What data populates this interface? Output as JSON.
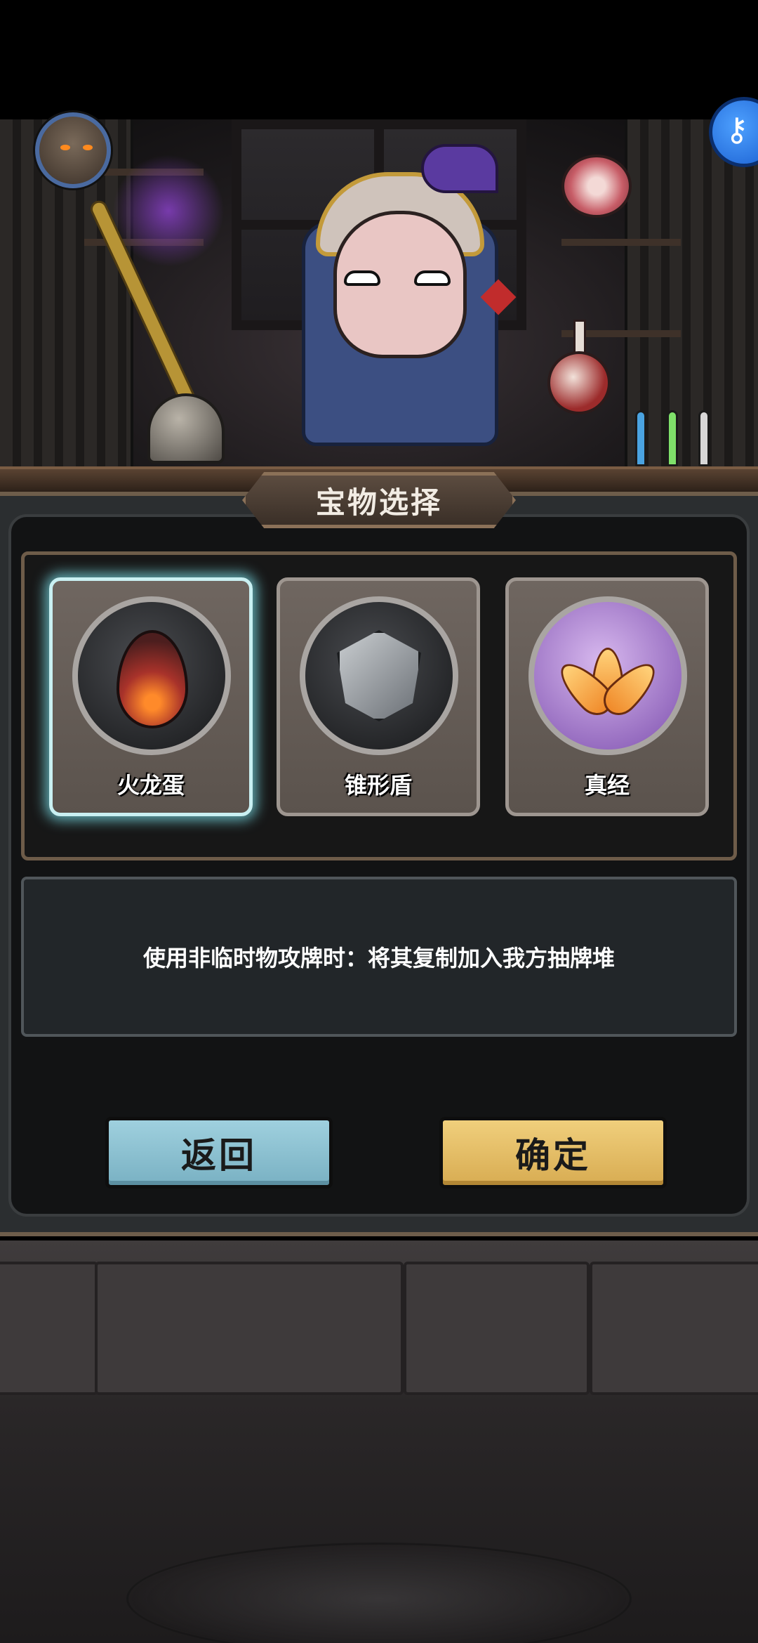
{
  "hud": {
    "avatar_icon": "hero-portrait-icon",
    "key_icon": "key-icon"
  },
  "scene": {
    "description_icons": [
      "merchant-character",
      "magic-staff",
      "knight-helmet",
      "potion-flask",
      "ham-meat"
    ]
  },
  "panel": {
    "title": "宝物选择"
  },
  "treasures": [
    {
      "name": "火龙蛋",
      "icon": "dragon-egg-icon",
      "selected": true
    },
    {
      "name": "锥形盾",
      "icon": "cone-shield-icon",
      "selected": false
    },
    {
      "name": "真经",
      "icon": "lotus-icon",
      "selected": false
    }
  ],
  "description": {
    "text": "使用非临时物攻牌时：将其复制加入我方抽牌堆"
  },
  "buttons": {
    "back_label": "返回",
    "confirm_label": "确定"
  },
  "colors": {
    "back_button": "#8fc2d2",
    "confirm_button": "#e6bd64",
    "selected_glow": "#8fe3ea",
    "panel_border": "#6e5d4b"
  }
}
